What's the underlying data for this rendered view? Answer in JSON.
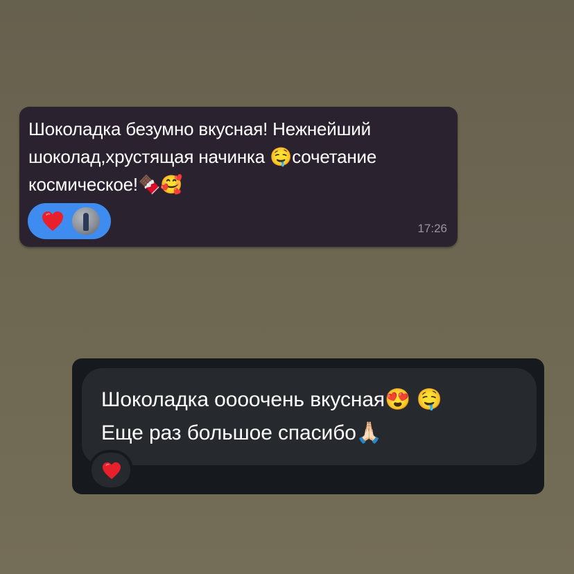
{
  "messages": [
    {
      "text_line_1": "Шоколадка безумно вкусная! Нежнейший",
      "text_line_2": "шоколад,хрустящая начинка 🤤сочетание",
      "text_line_3": "космическое!🍫🥰",
      "reactions": [
        {
          "icon": "heart-icon",
          "count": 1
        }
      ],
      "reactor_avatar": "avatar",
      "time": "17:26",
      "colors": {
        "bubble": "#2b2230",
        "reaction_pill": "#3f8cf0"
      }
    },
    {
      "text_line_1": "Шоколадка оооочень вкусная😍 🤤",
      "text_line_2": "Еще раз большое спасибо🙏🏻",
      "reactions": [
        {
          "icon": "heart-icon"
        }
      ],
      "colors": {
        "card": "#161a1f",
        "bubble": "#262a2f"
      }
    }
  ]
}
